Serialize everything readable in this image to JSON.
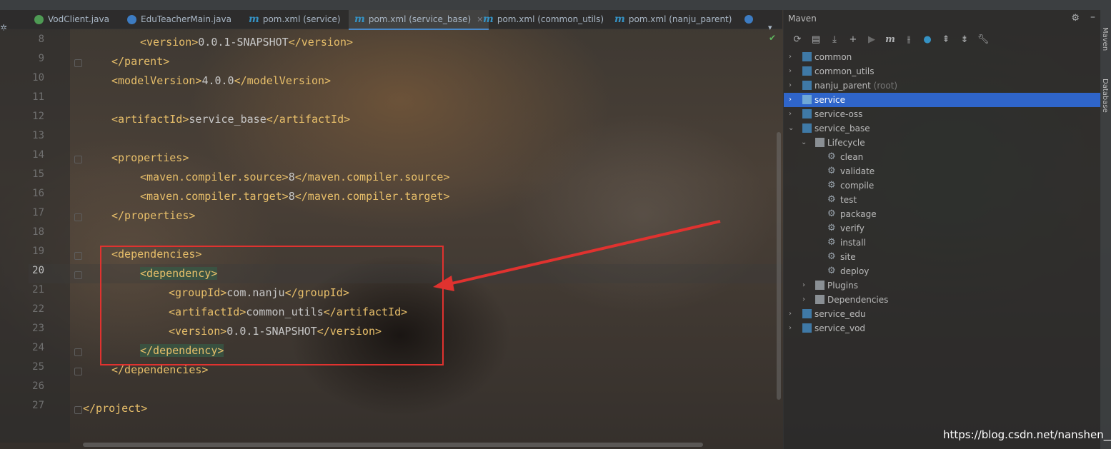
{
  "tabs": [
    {
      "label": "VodClient.java",
      "icon": "class-icon"
    },
    {
      "label": "EduTeacherMain.java",
      "icon": "main-class-icon"
    },
    {
      "label": "pom.xml (service)",
      "icon": "maven-icon"
    },
    {
      "label": "pom.xml (service_base)",
      "icon": "maven-icon",
      "active": true
    },
    {
      "label": "pom.xml (common_utils)",
      "icon": "maven-icon"
    },
    {
      "label": "pom.xml (nanju_parent)",
      "icon": "maven-icon"
    }
  ],
  "editor": {
    "line_numbers": [
      "8",
      "9",
      "10",
      "11",
      "12",
      "13",
      "14",
      "15",
      "16",
      "17",
      "18",
      "19",
      "20",
      "21",
      "22",
      "23",
      "24",
      "25",
      "26",
      "27"
    ],
    "current_line": "20",
    "lines": {
      "l8": {
        "open": "<version>",
        "text": "0.0.1-SNAPSHOT",
        "close": "</version>"
      },
      "l9": {
        "open": "</parent>"
      },
      "l10": {
        "open": "<modelVersion>",
        "text": "4.0.0",
        "close": "</modelVersion>"
      },
      "l12": {
        "open": "<artifactId>",
        "text": "service_base",
        "close": "</artifactId>"
      },
      "l14": {
        "open": "<properties>"
      },
      "l15": {
        "open": "<maven.compiler.source>",
        "text": "8",
        "close": "</maven.compiler.source>"
      },
      "l16": {
        "open": "<maven.compiler.target>",
        "text": "8",
        "close": "</maven.compiler.target>"
      },
      "l17": {
        "open": "</properties>"
      },
      "l19": {
        "open": "<dependencies>"
      },
      "l20": {
        "open": "<dependency>"
      },
      "l21": {
        "open": "<groupId>",
        "text": "com.nanju",
        "close": "</groupId>"
      },
      "l22": {
        "open": "<artifactId>",
        "text": "common_utils",
        "close": "</artifactId>"
      },
      "l23": {
        "open": "<version>",
        "text": "0.0.1-SNAPSHOT",
        "close": "</version>"
      },
      "l24": {
        "open": "</dependency>"
      },
      "l25": {
        "open": "</dependencies>"
      },
      "l27": {
        "open": "</project>"
      }
    }
  },
  "maven": {
    "title": "Maven",
    "toolbar": [
      "reload-icon",
      "generate-sources-icon",
      "download-icon",
      "add-icon",
      "run-icon",
      "m-icon",
      "toggle-offline-icon",
      "skip-tests-icon",
      "expand-all-icon",
      "collapse-all-icon",
      "wrench-icon"
    ],
    "tree": [
      {
        "label": "common"
      },
      {
        "label": "common_utils"
      },
      {
        "label": "nanju_parent",
        "suffix": "(root)"
      },
      {
        "label": "service",
        "selected": true
      },
      {
        "label": "service-oss"
      },
      {
        "label": "service_base",
        "expanded": true
      },
      {
        "label": "Lifecycle"
      },
      {
        "label": "clean"
      },
      {
        "label": "validate"
      },
      {
        "label": "compile"
      },
      {
        "label": "test"
      },
      {
        "label": "package"
      },
      {
        "label": "verify"
      },
      {
        "label": "install"
      },
      {
        "label": "site"
      },
      {
        "label": "deploy"
      },
      {
        "label": "Plugins"
      },
      {
        "label": "Dependencies"
      },
      {
        "label": "service_edu"
      },
      {
        "label": "service_vod"
      }
    ]
  },
  "side_tabs": {
    "maven": "Maven",
    "database": "Database"
  },
  "watermark": "https://blog.csdn.net/nanshen__",
  "colors": {
    "accent": "#2f65ca",
    "tag": "#e8bf6a",
    "annotation_box": "#e0322f"
  }
}
